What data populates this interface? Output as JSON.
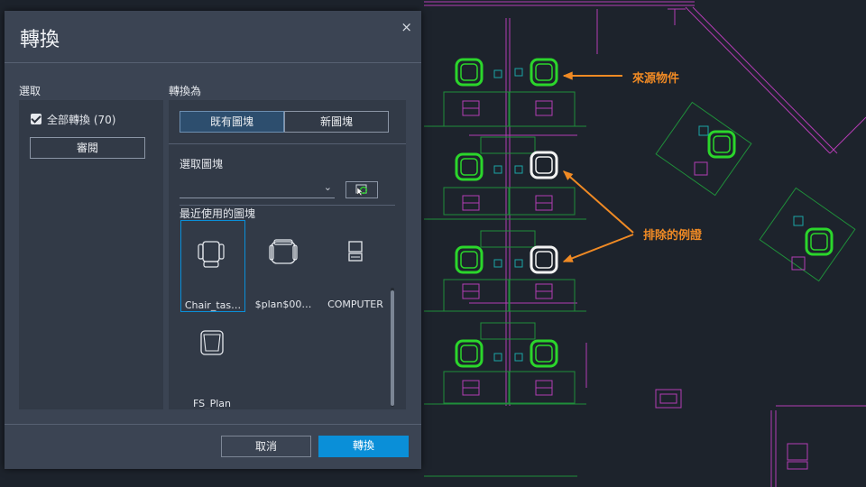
{
  "dialog": {
    "title": "轉換",
    "close_glyph": "×",
    "select_label": "選取",
    "convert_to_label": "轉換為",
    "convert_all_label": "全部轉換 (70)",
    "convert_all_checked": true,
    "review_button": "審閱",
    "existing_block_tab": "既有圖塊",
    "new_block_tab": "新圖塊",
    "select_block_label": "選取圖塊",
    "recent_blocks_label": "最近使用的圖塊",
    "recent_blocks": [
      {
        "label": "Chair_tas…",
        "icon": "task-chair-icon",
        "selected": true
      },
      {
        "label": "$plan$00…",
        "icon": "armchair-icon",
        "selected": false
      },
      {
        "label": "COMPUTER",
        "icon": "computer-icon",
        "selected": false
      },
      {
        "label": "FS_Plan",
        "icon": "chair-plan-icon",
        "selected": false
      }
    ],
    "cancel_button": "取消",
    "convert_button": "轉換"
  },
  "annotations": {
    "source_object": "來源物件",
    "excluded_example": "排除的例證"
  },
  "colors": {
    "dialog_bg": "#3b4453",
    "panel_bg": "#323a47",
    "primary_button": "#0a8fd8",
    "selected_tab": "#2d4e6e",
    "annotation": "#f08a24",
    "cad_magenta": "#b43cb4",
    "cad_green": "#2bd62b",
    "cad_teal": "#1aa6a6"
  }
}
